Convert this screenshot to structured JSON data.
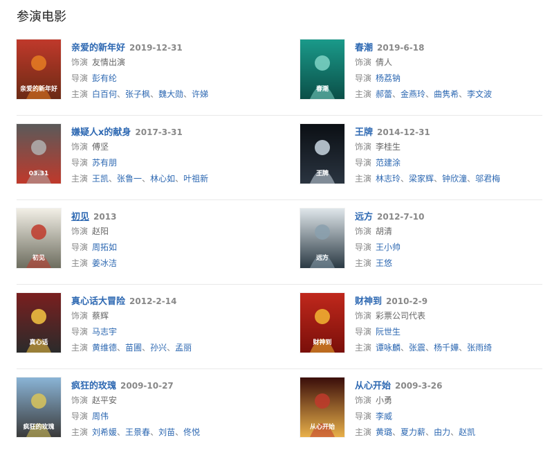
{
  "section_title": "参演电影",
  "labels": {
    "role": "饰演",
    "director": "导演",
    "cast": "主演"
  },
  "films": [
    {
      "title": "亲爱的新年好",
      "date": "2019-12-31",
      "role": "友情出演",
      "director": "彭有纶",
      "cast": [
        "白百何",
        "张子枫",
        "魏大勋",
        "许娣"
      ],
      "poster_icon": "poster-dear-new-year",
      "poster_text": "亲爱的新年好",
      "palette": [
        "#c0392b",
        "#e67e22",
        "#6b2a14"
      ]
    },
    {
      "title": "春潮",
      "date": "2019-6-18",
      "role": "倩人",
      "director": "杨荔钠",
      "cast": [
        "郝蕾",
        "金燕玲",
        "曲隽希",
        "李文波"
      ],
      "poster_icon": "poster-spring-tide",
      "poster_text": "春潮",
      "palette": [
        "#1a9a8a",
        "#7fd3c6",
        "#0b4f48"
      ]
    },
    {
      "title": "嫌疑人x的献身",
      "date": "2017-3-31",
      "role": "傅坚",
      "director": "苏有朋",
      "cast": [
        "王凯",
        "张鲁一",
        "林心如",
        "叶祖新"
      ],
      "poster_icon": "poster-suspect-x",
      "poster_text": "03.31",
      "palette": [
        "#5a5a5a",
        "#b0b0b0",
        "#c0392b"
      ]
    },
    {
      "title": "王牌",
      "date": "2014-12-31",
      "role": "李桂生",
      "director": "范建涂",
      "cast": [
        "林志玲",
        "梁家辉",
        "钟欣潼",
        "邬君梅"
      ],
      "poster_icon": "poster-trump-card",
      "poster_text": "王牌",
      "palette": [
        "#0b0f14",
        "#c9d6e0",
        "#2a3440"
      ]
    },
    {
      "title": "初见",
      "date": "2013",
      "role": "赵阳",
      "director": "周拓如",
      "cast": [
        "姜冰洁"
      ],
      "poster_icon": "poster-first-sight",
      "poster_text": "初见",
      "palette": [
        "#f2efe6",
        "#c0392b",
        "#6d6d5f"
      ],
      "underlined": true
    },
    {
      "title": "远方",
      "date": "2012-7-10",
      "role": "胡清",
      "director": "王小帅",
      "cast": [
        "王悠"
      ],
      "poster_icon": "poster-faraway",
      "poster_text": "远方",
      "palette": [
        "#dfe6ea",
        "#8aa0ae",
        "#2b3a44"
      ]
    },
    {
      "title": "真心话大冒险",
      "date": "2012-2-14",
      "role": "蔡辉",
      "director": "马志宇",
      "cast": [
        "黄维德",
        "苗圃",
        "孙兴",
        "孟丽"
      ],
      "poster_icon": "poster-truth-or-dare",
      "poster_text": "真心话",
      "palette": [
        "#7a1f1f",
        "#f4c542",
        "#2b2b2b"
      ]
    },
    {
      "title": "财神到",
      "date": "2010-2-9",
      "role": "彩票公司代表",
      "director": "阮世生",
      "cast": [
        "谭咏麟",
        "张震",
        "杨千嬅",
        "张雨绮"
      ],
      "poster_icon": "poster-god-of-fortune",
      "poster_text": "财神到",
      "palette": [
        "#c0281c",
        "#f2b632",
        "#7a0f0a"
      ]
    },
    {
      "title": "疯狂的玫瑰",
      "date": "2009-10-27",
      "role": "赵平安",
      "director": "周伟",
      "cast": [
        "刘希媛",
        "王景春",
        "刘苗",
        "佟悦"
      ],
      "poster_icon": "poster-crazy-rose",
      "poster_text": "疯狂的玫瑰",
      "palette": [
        "#8ab4d6",
        "#d9c45a",
        "#3a3a3a"
      ]
    },
    {
      "title": "从心开始",
      "date": "2009-3-26",
      "role": "小勇",
      "director": "李威",
      "cast": [
        "黄璐",
        "夏力薪",
        "由力",
        "赵凯"
      ],
      "poster_icon": "poster-from-the-heart",
      "poster_text": "从心开始",
      "palette": [
        "#3a0d0a",
        "#c0392b",
        "#e8b04a"
      ]
    }
  ]
}
